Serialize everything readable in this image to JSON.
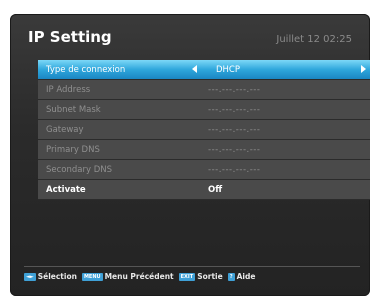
{
  "header": {
    "title": "IP Setting",
    "datetime": "Juillet 12 02:25"
  },
  "rows": [
    {
      "label": "Type de connexion",
      "value": "DHCP"
    },
    {
      "label": "IP Address",
      "value": "---.---.---.---"
    },
    {
      "label": "Subnet Mask",
      "value": "---.---.---.---"
    },
    {
      "label": "Gateway",
      "value": "---.---.---.---"
    },
    {
      "label": "Primary DNS",
      "value": "---.---.---.---"
    },
    {
      "label": "Secondary DNS",
      "value": "---.---.---.---"
    },
    {
      "label": "Activate",
      "value": "Off"
    }
  ],
  "footer": {
    "keys": [
      {
        "key": "◄►",
        "label": "Sélection"
      },
      {
        "key": "MENU",
        "label": "Menu Précédent"
      },
      {
        "key": "EXIT",
        "label": "Sortie"
      },
      {
        "key": "?",
        "label": "Aide"
      }
    ]
  },
  "colors": {
    "highlight": "#2fa7dc",
    "row_bg": "#4a4a4a",
    "key_bg": "#3fa0d6"
  }
}
